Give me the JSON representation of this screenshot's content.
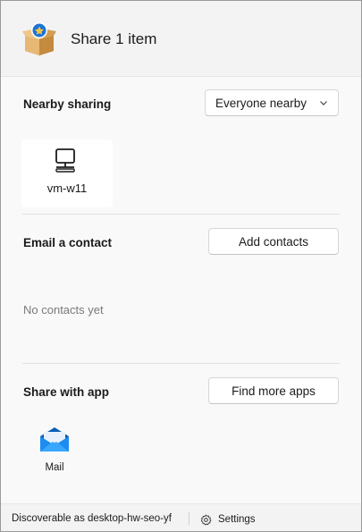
{
  "window": {
    "title": "Share 1 item"
  },
  "nearby": {
    "label": "Nearby sharing",
    "dropdown_value": "Everyone nearby",
    "devices": [
      {
        "name": "vm-w11",
        "icon": "computer-icon"
      }
    ]
  },
  "email": {
    "label": "Email a contact",
    "add_button": "Add contacts",
    "empty_text": "No contacts yet"
  },
  "apps": {
    "label": "Share with app",
    "find_button": "Find more apps",
    "items": [
      {
        "name": "Mail",
        "icon": "mail-icon"
      }
    ]
  },
  "footer": {
    "discoverable_text": "Discoverable as desktop-hw-seo-yf",
    "settings_label": "Settings"
  },
  "colors": {
    "accent": "#0078d4",
    "background": "#f3f3f3",
    "tile": "#ffffff"
  }
}
